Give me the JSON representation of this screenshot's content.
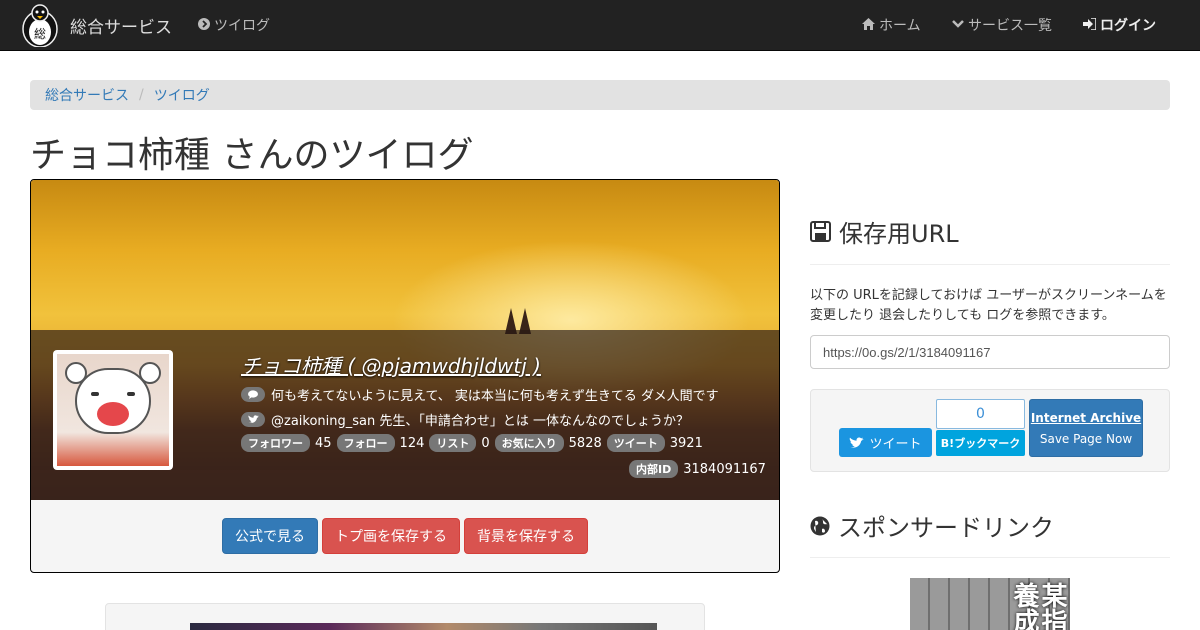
{
  "navbar": {
    "brand_logo_text": "総",
    "brand": "総合サービス",
    "twilog_link": "ツイログ",
    "home": "ホーム",
    "services": "サービス一覧",
    "login": "ログイン"
  },
  "breadcrumb": {
    "items": [
      "総合サービス",
      "ツイログ"
    ],
    "separator": "/"
  },
  "page_title": "チョコ柿種 さんのツイログ",
  "profile": {
    "name": "チョコ柿種 ( @pjamwdhjldwtj )",
    "bio": "何も考えてないように見えて、 実は本当に何も考えず生きてる ダメ人間です",
    "latest_tweet": "@zaikoning_san 先生、「申請合わせ」とは 一体なんなのでしょうか？",
    "stats": [
      {
        "label": "フォロワー",
        "value": "45"
      },
      {
        "label": "フォロー",
        "value": "124"
      },
      {
        "label": "リスト",
        "value": "0"
      },
      {
        "label": "お気に入り",
        "value": "5828"
      },
      {
        "label": "ツイート",
        "value": "3921"
      }
    ],
    "internal_id_label": "内部ID",
    "internal_id": "3184091167",
    "buttons": {
      "official": "公式で見る",
      "save_icon": "トプ画を保存する",
      "save_bg": "背景を保存する"
    }
  },
  "save_url": {
    "heading": "保存用URL",
    "description": "以下の URLを記録しておけば ユーザーがスクリーンネームを変更したり 退会したりしても ログを参照できます。",
    "url": "https://0o.gs/2/1/3184091167"
  },
  "share": {
    "tweet": "ツイート",
    "hatena_count": "0",
    "hatena_label": "B!ブックマーク",
    "ia_title": "Internet Archive",
    "ia_sub": "Save Page Now"
  },
  "sponsor": {
    "heading": "スポンサードリンク",
    "ad_text": "某指養成"
  },
  "colors": {
    "navbar": "#222222",
    "primary": "#337ab7",
    "danger": "#d9534f",
    "twitter": "#1b95e0",
    "hatena": "#00a4de"
  }
}
